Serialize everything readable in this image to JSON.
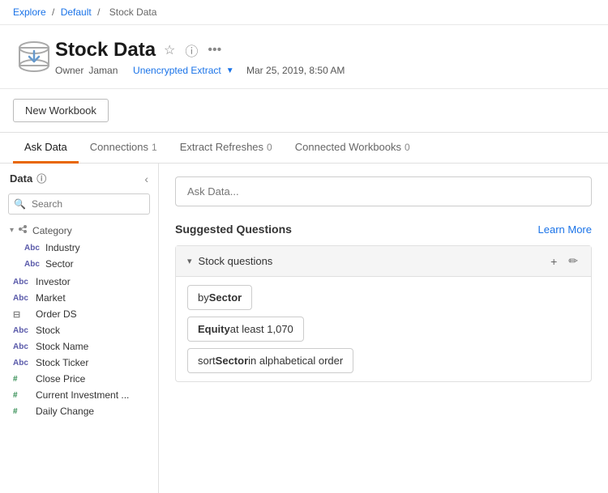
{
  "breadcrumb": {
    "explore": "Explore",
    "default": "Default",
    "current": "Stock Data",
    "separator": "/"
  },
  "header": {
    "title": "Stock Data",
    "owner_label": "Owner",
    "owner_name": "Jaman",
    "extract_text": "Unencrypted Extract",
    "date": "Mar 25, 2019, 8:50 AM",
    "star_icon": "★",
    "info_icon": "ⓘ",
    "more_icon": "•••"
  },
  "new_workbook_btn": "New Workbook",
  "tabs": [
    {
      "label": "Ask Data",
      "badge": "",
      "active": true
    },
    {
      "label": "Connections",
      "badge": "1",
      "active": false
    },
    {
      "label": "Extract Refreshes",
      "badge": "0",
      "active": false
    },
    {
      "label": "Connected Workbooks",
      "badge": "0",
      "active": false
    }
  ],
  "sidebar": {
    "title": "Data",
    "collapse_label": "‹",
    "search_placeholder": "Search",
    "category_group": {
      "label": "Category",
      "children": [
        {
          "type": "Abc",
          "name": "Industry"
        },
        {
          "type": "Abc",
          "name": "Sector"
        }
      ]
    },
    "standalone_items": [
      {
        "type": "Abc",
        "name": "Investor"
      },
      {
        "type": "Abc",
        "name": "Market"
      },
      {
        "type": "db",
        "name": "Order DS"
      },
      {
        "type": "Abc",
        "name": "Stock"
      },
      {
        "type": "Abc",
        "name": "Stock Name"
      },
      {
        "type": "Abc",
        "name": "Stock Ticker"
      },
      {
        "type": "#",
        "name": "Close Price"
      },
      {
        "type": "#",
        "name": "Current Investment ..."
      },
      {
        "type": "#",
        "name": "Daily Change"
      }
    ]
  },
  "main": {
    "ask_data_placeholder": "Ask Data...",
    "suggested_title": "Suggested Questions",
    "learn_more": "Learn More",
    "questions_group_label": "Stock questions",
    "questions": [
      {
        "prefix": "by ",
        "bold": "Sector",
        "suffix": ""
      },
      {
        "prefix": "",
        "bold": "Equity",
        "suffix": " at least 1,070"
      },
      {
        "prefix": "sort ",
        "bold": "Sector",
        "suffix": " in alphabetical order"
      }
    ]
  }
}
